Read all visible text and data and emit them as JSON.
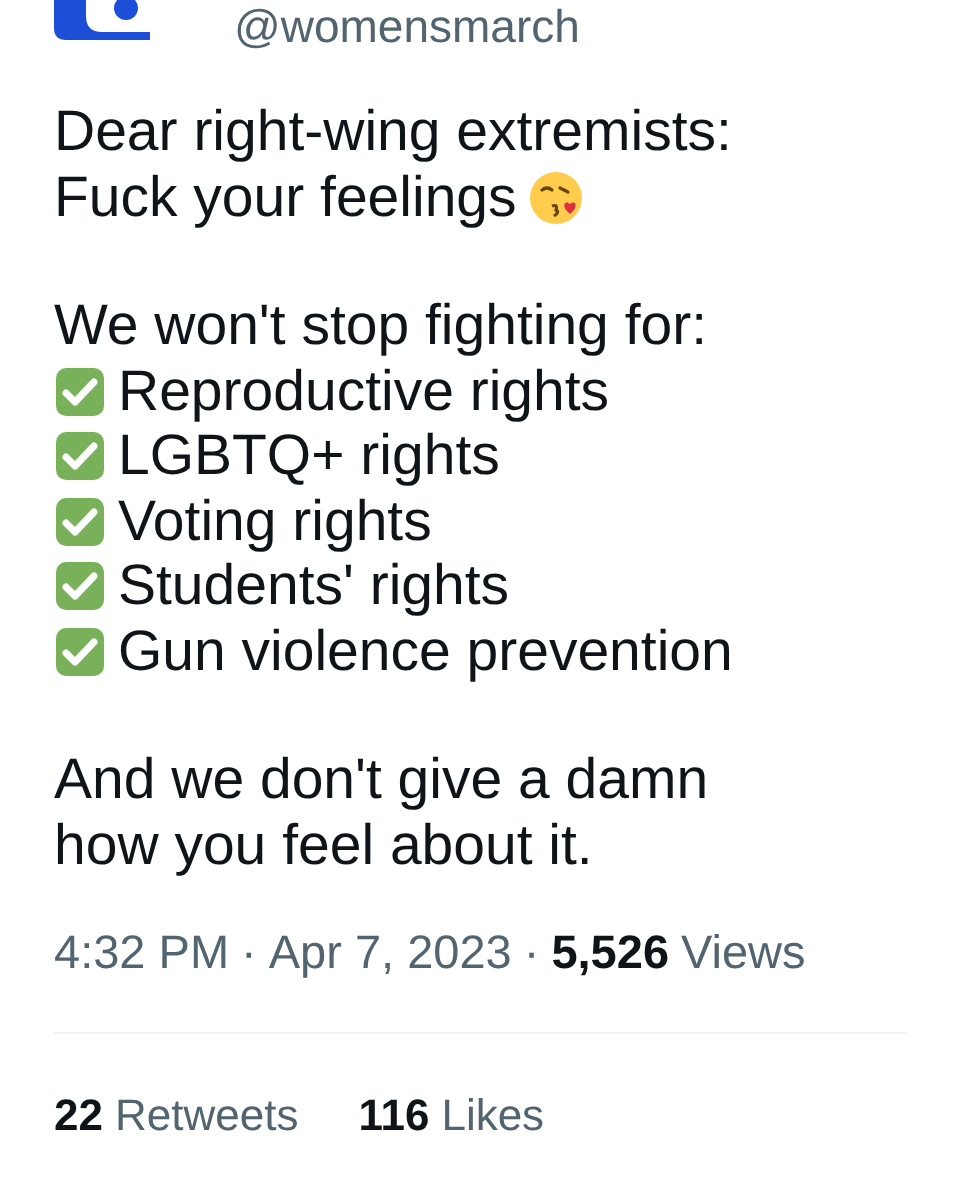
{
  "author": {
    "handle": "@womensmarch"
  },
  "intro": [
    "Dear right-wing extremists:",
    "Fuck your feelings"
  ],
  "list_heading": "We won't stop fighting for:",
  "checklist": [
    "Reproductive rights",
    "LGBTQ+ rights",
    "Voting rights",
    "Students' rights",
    "Gun violence prevention"
  ],
  "closing": [
    "And we don't give a damn",
    "how you feel about it."
  ],
  "meta": {
    "time": "4:32 PM",
    "separator": "·",
    "date": "Apr 7, 2023",
    "views_count": "5,526",
    "views_label": "Views"
  },
  "stats": [
    {
      "count": "22",
      "label": "Retweets"
    },
    {
      "count": "116",
      "label": "Likes"
    }
  ]
}
